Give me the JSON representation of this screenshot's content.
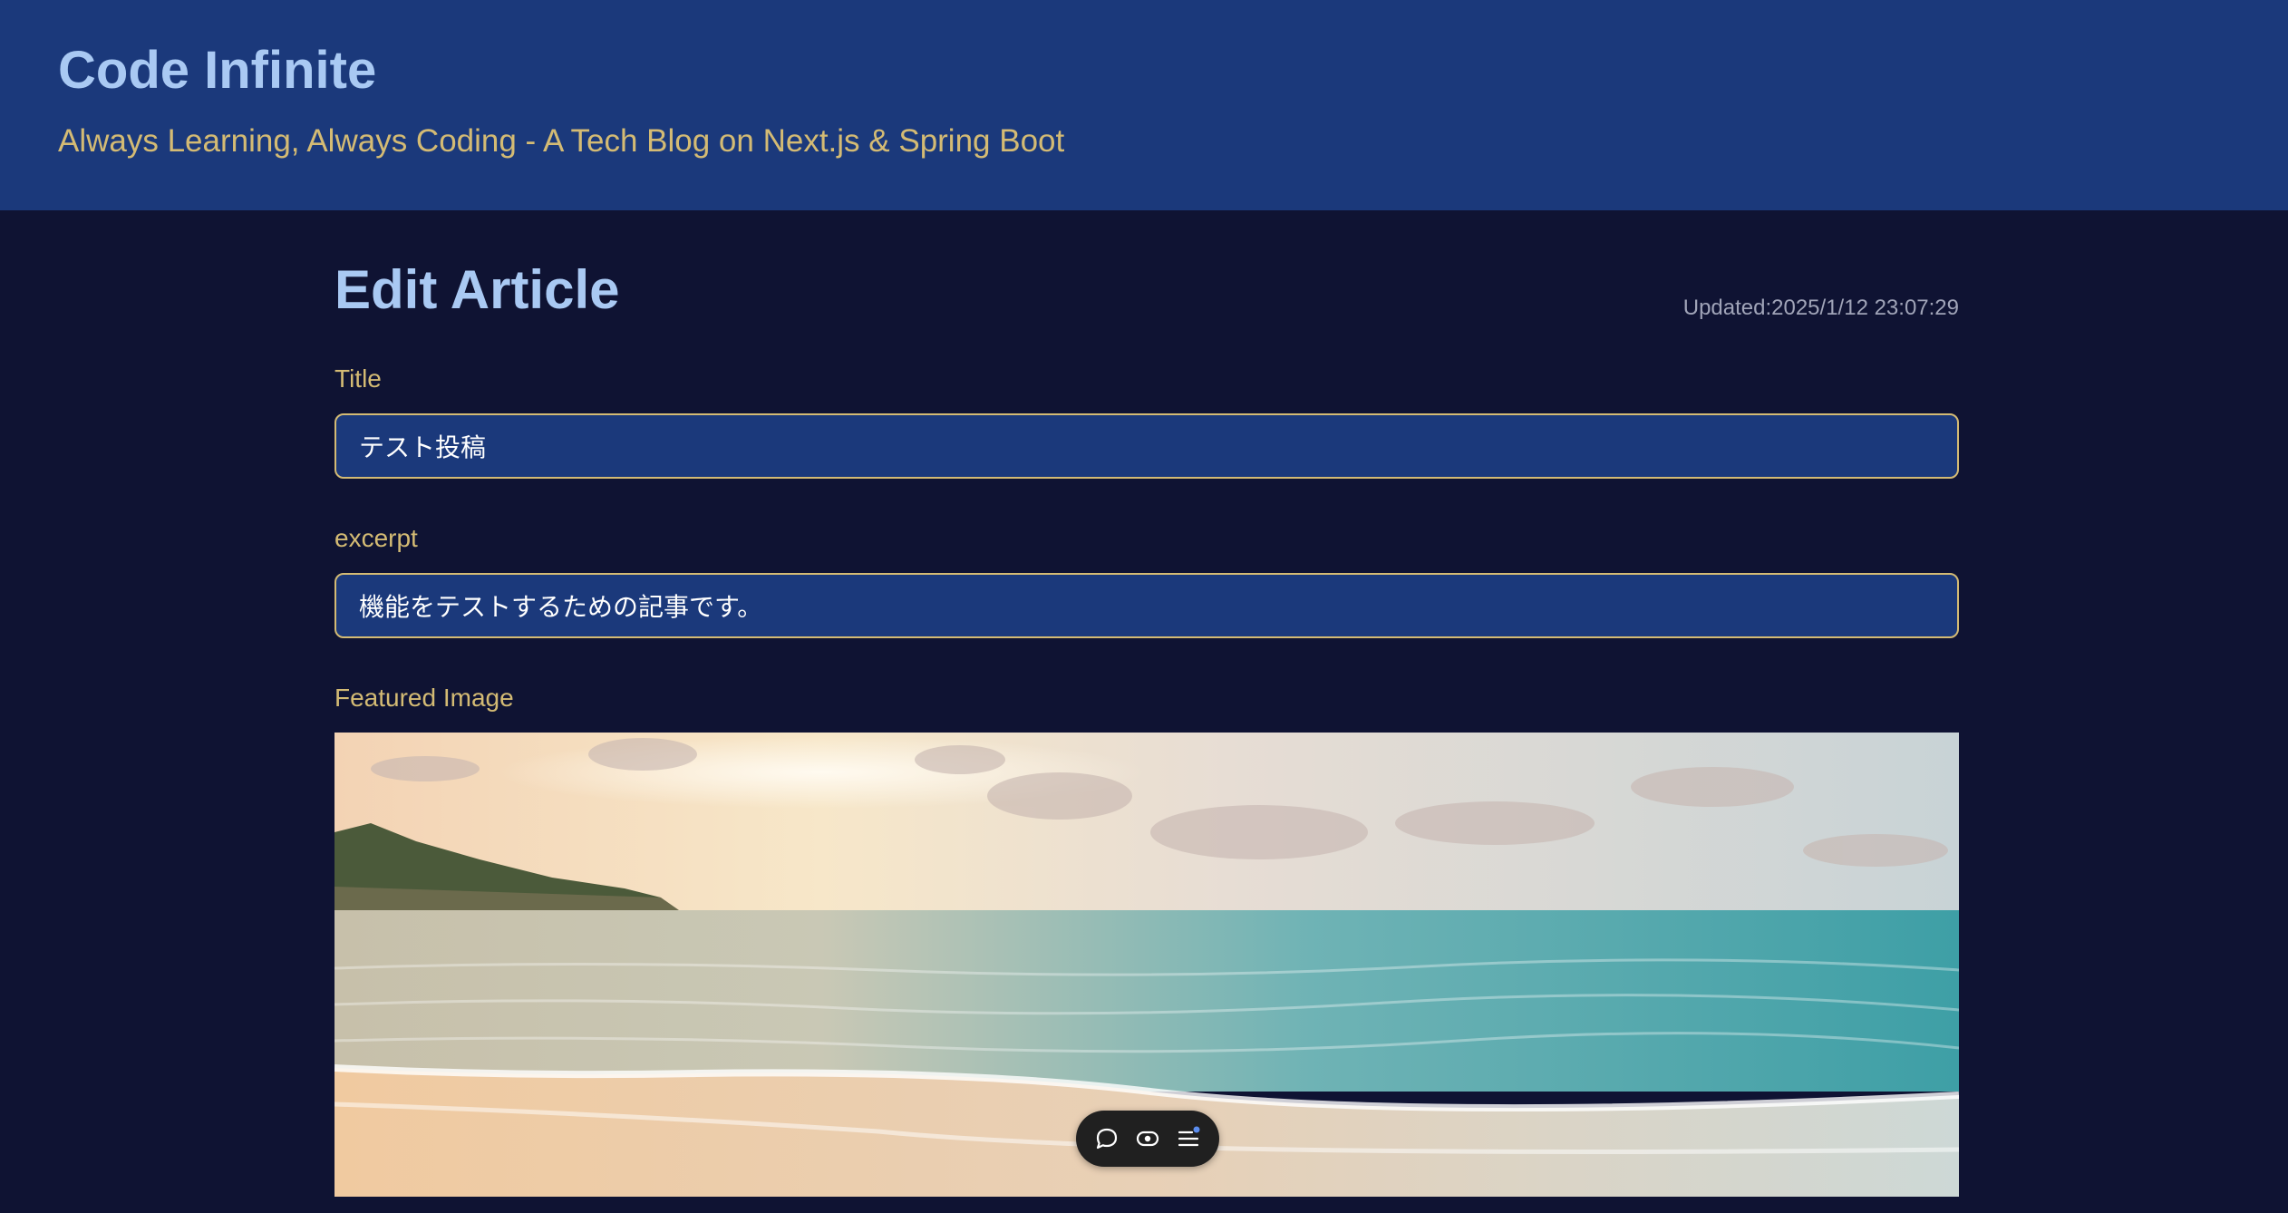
{
  "header": {
    "title": "Code Infinite",
    "tagline": "Always Learning, Always Coding - A Tech Blog on Next.js & Spring Boot"
  },
  "page": {
    "title": "Edit Article",
    "updated": "Updated:2025/1/12 23:07:29"
  },
  "form": {
    "title_label": "Title",
    "title_value": "テスト投稿",
    "excerpt_label": "excerpt",
    "excerpt_value": "機能をテストするための記事です。",
    "image_label": "Featured Image"
  },
  "toolbar": {
    "icons": [
      "chat-bubble-icon",
      "eye-icon",
      "menu-lines-icon"
    ],
    "badge_color": "#5b8def"
  },
  "colors": {
    "header_bg": "#1b397b",
    "page_bg": "#0f1333",
    "heading": "#a9c9f3",
    "accent": "#d4bb74",
    "input_bg": "#1b397b"
  }
}
